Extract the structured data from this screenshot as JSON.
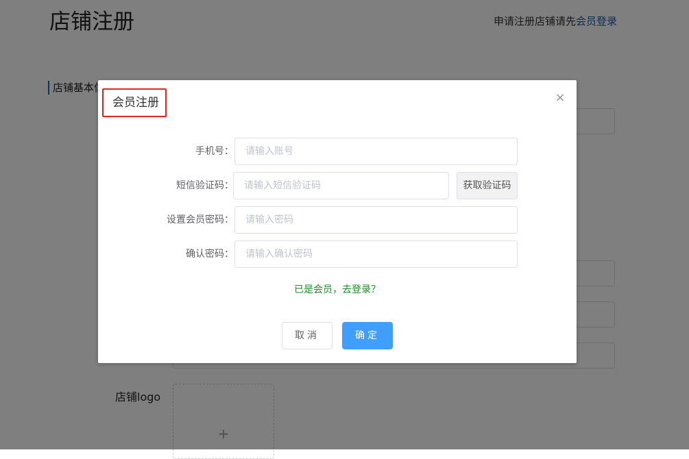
{
  "page": {
    "title": "店铺注册",
    "top_prompt": "申请注册店铺请先",
    "top_link": "会员登录",
    "section_title": "店铺基本信息",
    "logo_label": "店铺logo",
    "upload_plus": "+"
  },
  "dialog": {
    "title": "会员注册",
    "close_icon": "×",
    "fields": [
      {
        "label": "手机号：",
        "placeholder": "请输入账号"
      },
      {
        "label": "短信验证码：",
        "placeholder": "请输入短信验证码"
      },
      {
        "label": "设置会员密码：",
        "placeholder": "请输入密码"
      },
      {
        "label": "确认密码：",
        "placeholder": "请输入确认密码"
      }
    ],
    "get_code_label": "获取验证码",
    "login_link": "已是会员，去登录？",
    "cancel_label": "取消",
    "confirm_label": "确定"
  },
  "colors": {
    "accent": "#409eff",
    "link_green": "#1e8a2a",
    "highlight_red": "#e0261e",
    "top_link_blue": "#1a5aa6"
  }
}
